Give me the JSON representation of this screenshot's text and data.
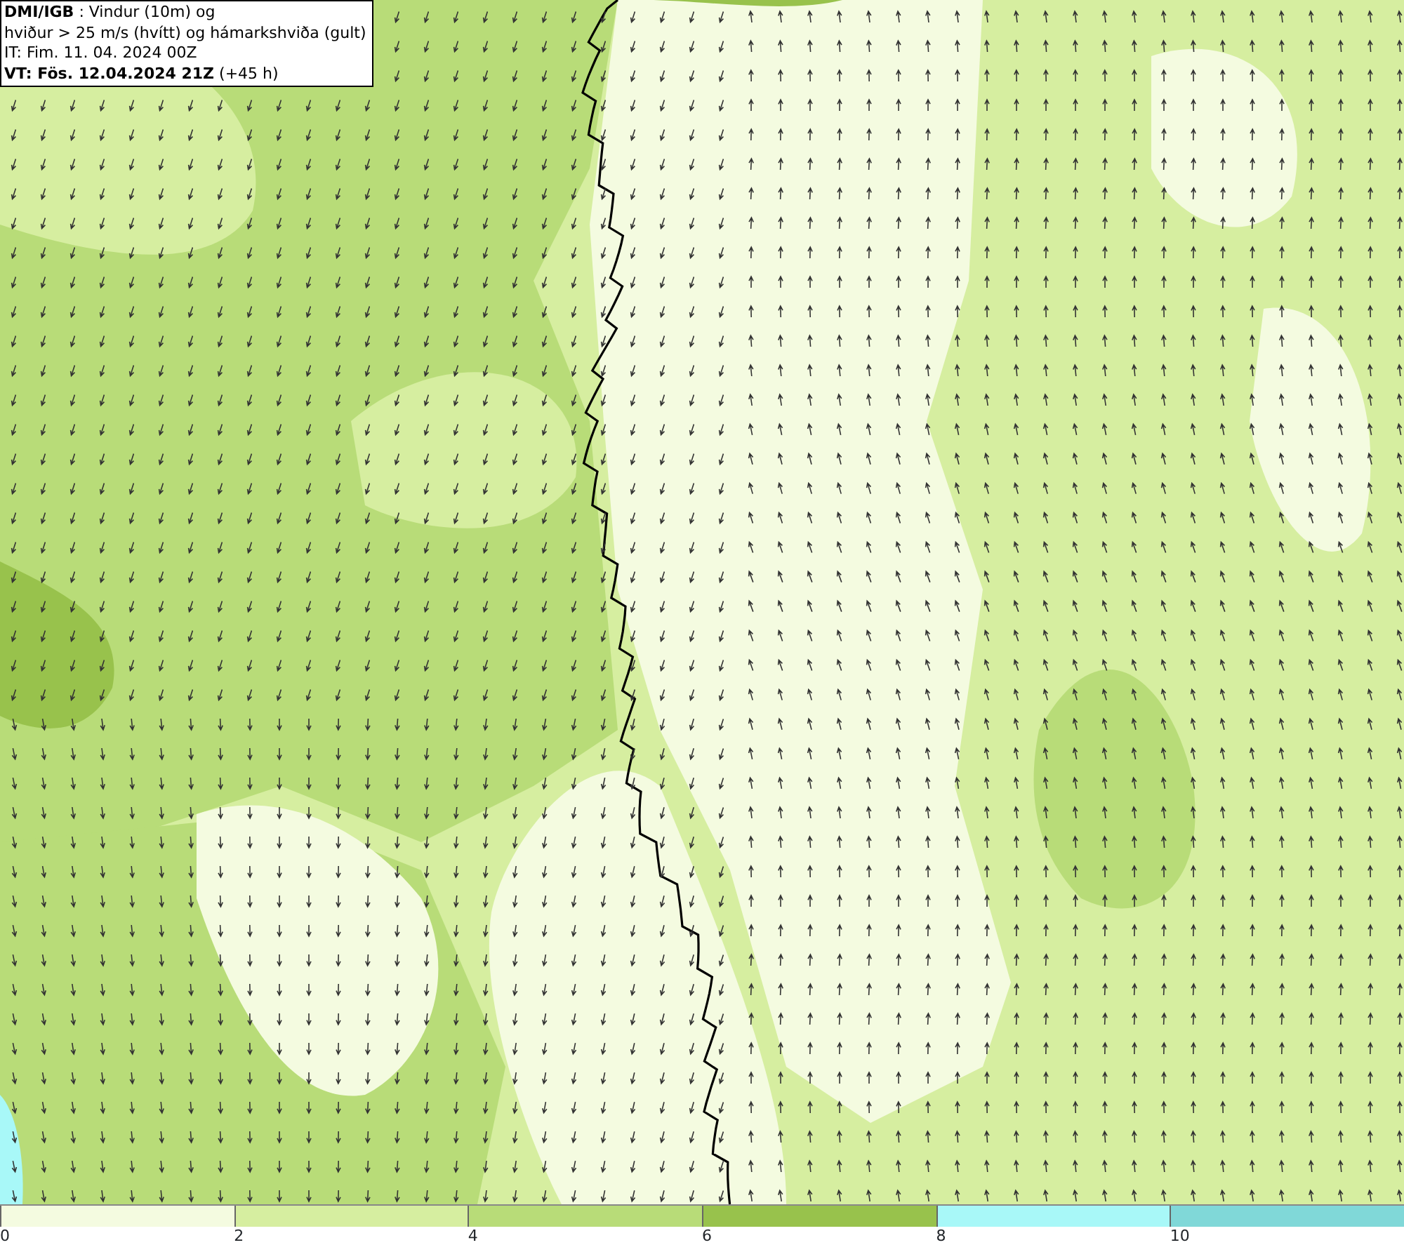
{
  "info_box": {
    "lines": [
      "**DMI/IGB** : Vindur (10m) og",
      "hviður > 25 m/s (hvítt) og hámarkshviða (gult)",
      "IT: Fim. 11. 04. 2024 00Z",
      "**VT: Fös. 12.04.2024 21Z** (+45 h)"
    ]
  },
  "legend": {
    "segments": [
      {
        "color": "#f4fbe0",
        "label": "0"
      },
      {
        "color": "#d6eea0",
        "label": "2"
      },
      {
        "color": "#b8dc78",
        "label": "4"
      },
      {
        "color": "#98c24c",
        "label": "6"
      },
      {
        "color": "#a8f8f8",
        "label": "8"
      },
      {
        "color": "#80d8d8",
        "label": "10"
      }
    ]
  }
}
